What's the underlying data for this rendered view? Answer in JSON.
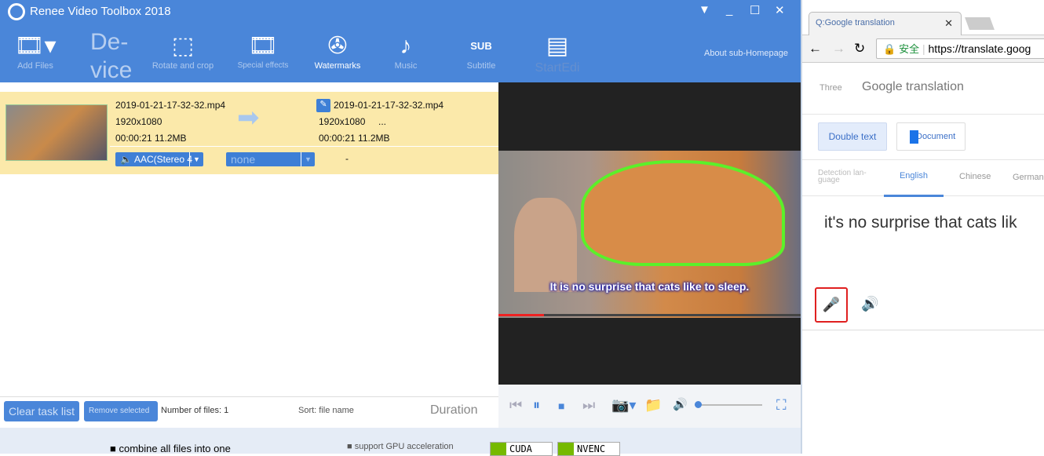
{
  "app": {
    "title": "Renee Video Toolbox 2018",
    "toolbar": [
      {
        "label": "Add Files",
        "icon": "film-add-icon"
      },
      {
        "label": "Rotate and crop",
        "icon": "crop-rotate-icon"
      },
      {
        "label": "Special effects",
        "icon": "film-sparkle-icon"
      },
      {
        "label": "Watermarks",
        "icon": "watermark-icon"
      },
      {
        "label": "Music",
        "icon": "music-note-icon"
      },
      {
        "label": "Subtitle",
        "icon": "subtitle-icon"
      },
      {
        "label": "StartEdi",
        "icon": "document-icon"
      }
    ],
    "device_label": "De-\nvice",
    "about": "About sub-Homepage",
    "file": {
      "source_name": "2019-01-21-17-32-32.mp4",
      "source_res": "1920x1080",
      "source_meta": "00:00:21  11.2MB",
      "out_name": "2019-01-21-17-32-32.mp4",
      "out_res": "1920x1080",
      "out_more": "...",
      "out_meta": "00:00:21  11.2MB",
      "audio": "AAC(Stereo 4",
      "subtitle": "none",
      "dash": "-"
    },
    "video_subtitle": "It is no surprise that cats like to sleep.",
    "bottom": {
      "clear": "Clear task list",
      "remove": "Remove selected",
      "count": "Number of files: 1",
      "sort": "Sort: file name",
      "duration": "Duration"
    },
    "footer": {
      "combine": "■ combine all files into one",
      "gpu": "■ support GPU acceleration",
      "cuda": "CUDA",
      "nvenc": "NVENC"
    },
    "accent": "#4a86d9"
  },
  "browser": {
    "tab": "Q:Google translation",
    "url": "https://translate.goog",
    "secure": "安全",
    "header_small": "Three",
    "header": "Google translation",
    "double_text": "Double text",
    "document": "Document",
    "langs": [
      "Detection lan-guage",
      "English",
      "Chinese",
      "German"
    ],
    "input_text": "it's no surprise that cats lik"
  }
}
